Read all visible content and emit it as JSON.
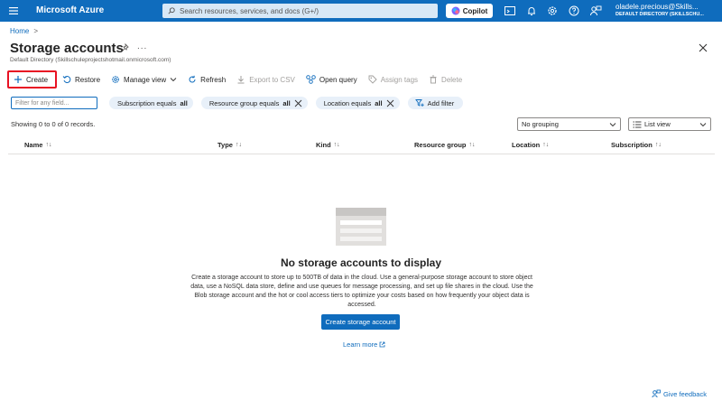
{
  "topbar": {
    "brand": "Microsoft Azure",
    "search_placeholder": "Search resources, services, and docs (G+/)",
    "copilot_label": "Copilot",
    "account_name": "oladele.precious@Skills...",
    "account_directory": "DEFAULT DIRECTORY (SKILLSCHU..."
  },
  "breadcrumb": {
    "home": "Home",
    "sep": ">"
  },
  "page": {
    "title": "Storage accounts",
    "more": "...",
    "subtitle": "Default Directory (Skillschuleprojectshotmail.onmicrosoft.com)"
  },
  "toolbar": {
    "create": "Create",
    "restore": "Restore",
    "manage_view": "Manage view",
    "refresh": "Refresh",
    "export_csv": "Export to CSV",
    "open_query": "Open query",
    "assign_tags": "Assign tags",
    "delete": "Delete"
  },
  "filters": {
    "placeholder": "Filter for any field...",
    "subscription_label": "Subscription equals",
    "subscription_value": "all",
    "resource_group_label": "Resource group equals",
    "resource_group_value": "all",
    "location_label": "Location equals",
    "location_value": "all",
    "add_filter": "Add filter"
  },
  "records_text": "Showing 0 to 0 of 0 records.",
  "grouping": {
    "value": "No grouping"
  },
  "view": {
    "value": "List view"
  },
  "table": {
    "columns": [
      {
        "label": "Name",
        "sort": "↑↓"
      },
      {
        "label": "Type",
        "sort": "↑↓"
      },
      {
        "label": "Kind",
        "sort": "↑↓"
      },
      {
        "label": "Resource group",
        "sort": "↑↓"
      },
      {
        "label": "Location",
        "sort": "↑↓"
      },
      {
        "label": "Subscription",
        "sort": "↑↓"
      }
    ]
  },
  "empty_state": {
    "title": "No storage accounts to display",
    "description": "Create a storage account to store up to 500TB of data in the cloud. Use a general-purpose storage account to store object data, use a NoSQL data store, define and use queues for message processing, and set up file shares in the cloud. Use the Blob storage account and the hot or cool access tiers to optimize your costs based on how frequently your object data is accessed.",
    "create_button": "Create storage account",
    "learn_more": "Learn more"
  },
  "feedback": "Give feedback",
  "colors": {
    "accent": "#0f6cbd",
    "highlight": "#e81123"
  }
}
